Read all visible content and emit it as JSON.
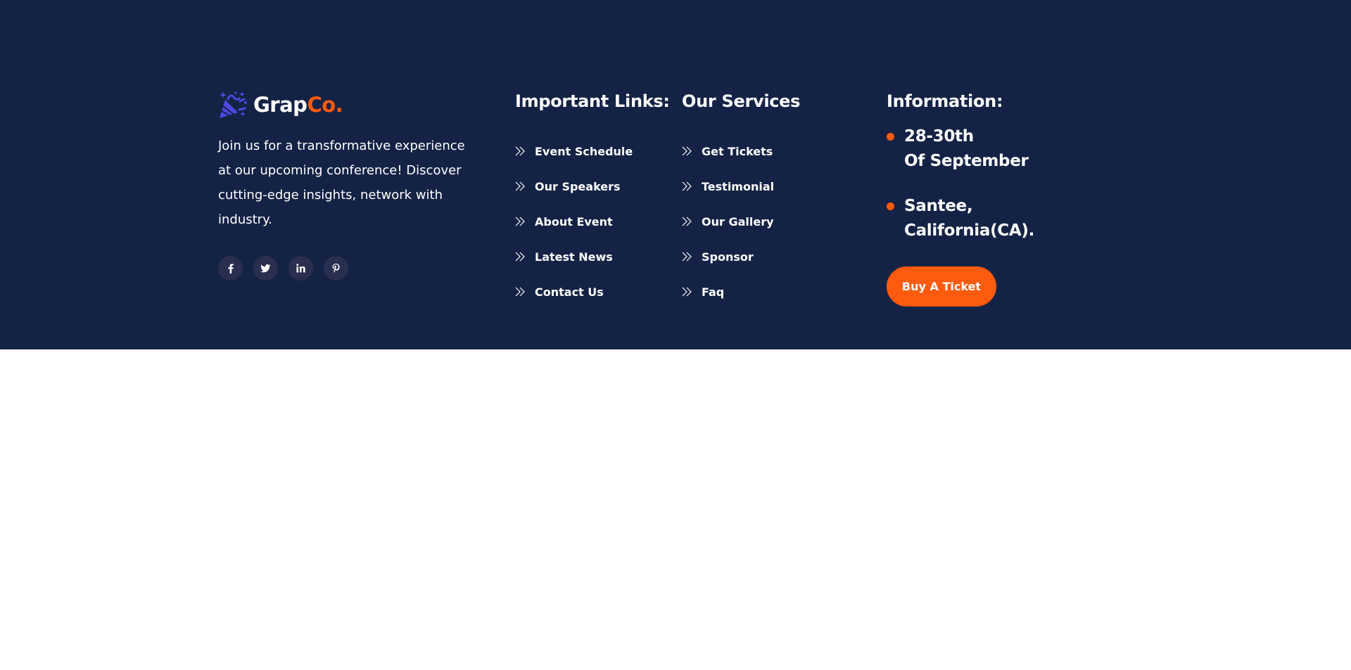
{
  "brand": {
    "name_main": "Grap",
    "name_accent": "Co.",
    "logo_icon": "party-popper-icon",
    "description": "Join us for a transformative experience at our upcoming conference! Discover cutting-edge insights, network with industry."
  },
  "socials": [
    {
      "icon": "facebook-icon"
    },
    {
      "icon": "twitter-icon"
    },
    {
      "icon": "linkedin-icon"
    },
    {
      "icon": "pinterest-icon"
    }
  ],
  "important_links": {
    "title": "Important Links:",
    "items": [
      {
        "label": "Event Schedule"
      },
      {
        "label": "Our Speakers"
      },
      {
        "label": "About Event"
      },
      {
        "label": "Latest News"
      },
      {
        "label": "Contact Us"
      }
    ]
  },
  "services": {
    "title": "Our Services",
    "items": [
      {
        "label": "Get Tickets"
      },
      {
        "label": "Testimonial"
      },
      {
        "label": "Our Gallery"
      },
      {
        "label": "Sponsor"
      },
      {
        "label": "Faq"
      }
    ]
  },
  "information": {
    "title": "Information:",
    "date_line1": "28-30th",
    "date_line2": "Of September",
    "location_line1": "Santee,",
    "location_line2": "California(CA).",
    "button_label": "Buy A Ticket"
  },
  "colors": {
    "footer_bg": "#142345",
    "accent": "#ff5b0f",
    "logo": "#4f46e5",
    "social_bg": "#2a2e4f",
    "page_bg": "#ffffff"
  }
}
